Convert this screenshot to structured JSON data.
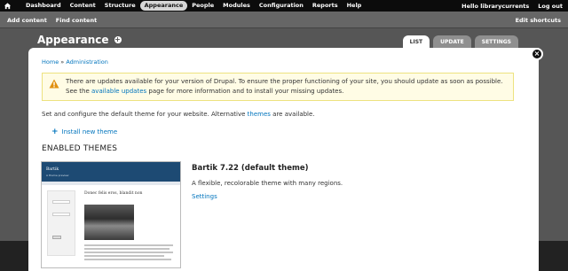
{
  "toolbar": {
    "items": [
      "Dashboard",
      "Content",
      "Structure",
      "Appearance",
      "People",
      "Modules",
      "Configuration",
      "Reports",
      "Help"
    ],
    "active": "Appearance",
    "user_greeting": "Hello librarycurrents",
    "logout": "Log out"
  },
  "shortcuts": {
    "add_content": "Add content",
    "find_content": "Find content",
    "edit_shortcuts": "Edit shortcuts"
  },
  "overlay": {
    "title": "Appearance",
    "tabs": [
      {
        "label": "LIST",
        "active": true
      },
      {
        "label": "UPDATE",
        "active": false
      },
      {
        "label": "SETTINGS",
        "active": false
      }
    ]
  },
  "breadcrumb": {
    "home": "Home",
    "separator": "»",
    "admin": "Administration"
  },
  "warning": {
    "text_1": "There are updates available for your version of Drupal. To ensure the proper functioning of your site, you should update as soon as possible. See the",
    "link": "available updates",
    "text_2": "page for more information and to install your missing updates."
  },
  "intro": {
    "text_1": "Set and configure the default theme for your website. Alternative",
    "link": "themes",
    "text_2": "are available."
  },
  "install_link": "Install new theme",
  "section_title": "ENABLED THEMES",
  "screenshot": {
    "site_name": "Bartik",
    "slogan": "A theme preview",
    "heading": "Donec felis eros, blandit non"
  },
  "theme": {
    "name": "Bartik 7.22 (default theme)",
    "description": "A flexible, recolorable theme with many regions.",
    "settings_link": "Settings"
  },
  "colors": {
    "link": "#0074bd",
    "toolbar": "#0c0c0c",
    "warning_bg": "#fffce5",
    "warning_border": "#ede280"
  }
}
